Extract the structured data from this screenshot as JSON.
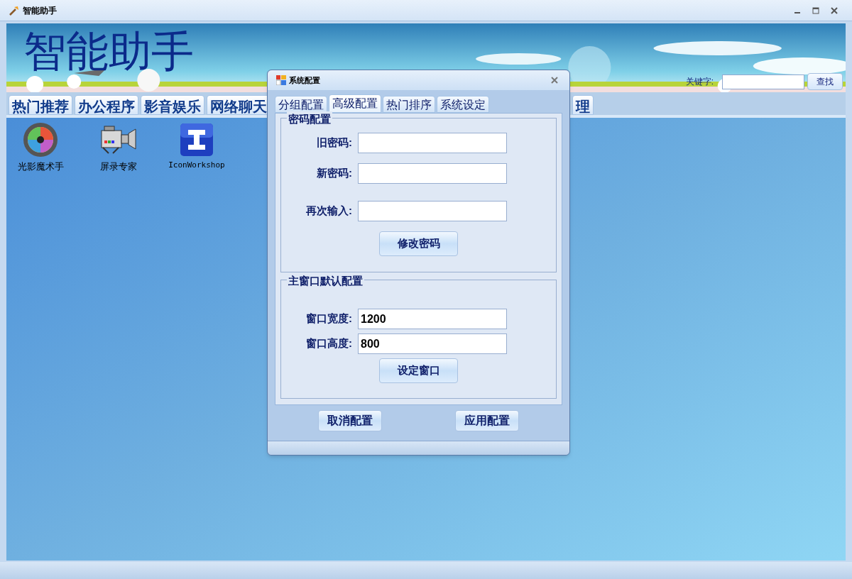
{
  "window": {
    "title": "智能助手"
  },
  "banner": {
    "title": "智能助手",
    "keyword_label": "关键字:",
    "search_button": "查找"
  },
  "main_tabs": [
    {
      "label": "热门推荐"
    },
    {
      "label": "办公程序"
    },
    {
      "label": "影音娱乐"
    },
    {
      "label": "网络聊天"
    },
    {
      "label": "理"
    }
  ],
  "desktop_items": [
    {
      "kind": "lens",
      "label": "光影魔术手"
    },
    {
      "kind": "camera",
      "label": "屏录专家"
    },
    {
      "kind": "letter",
      "label": "IconWorkshop"
    }
  ],
  "dialog": {
    "title": "系统配置",
    "tabs": [
      {
        "label": "分组配置",
        "selected": false
      },
      {
        "label": "高级配置",
        "selected": true
      },
      {
        "label": "热门排序",
        "selected": false
      },
      {
        "label": "系统设定",
        "selected": false
      }
    ],
    "groups": [
      {
        "title": "密码配置",
        "fields": [
          {
            "label": "旧密码:"
          },
          {
            "label": "新密码:"
          },
          {
            "label": "再次输入:"
          }
        ],
        "button": "修改密码"
      },
      {
        "title": "主窗口默认配置",
        "fields": [
          {
            "label": "窗口宽度:",
            "value": "1200"
          },
          {
            "label": "窗口高度:",
            "value": "800"
          }
        ],
        "button": "设定窗口"
      }
    ],
    "buttons": [
      "取消配置",
      "应用配置"
    ]
  }
}
